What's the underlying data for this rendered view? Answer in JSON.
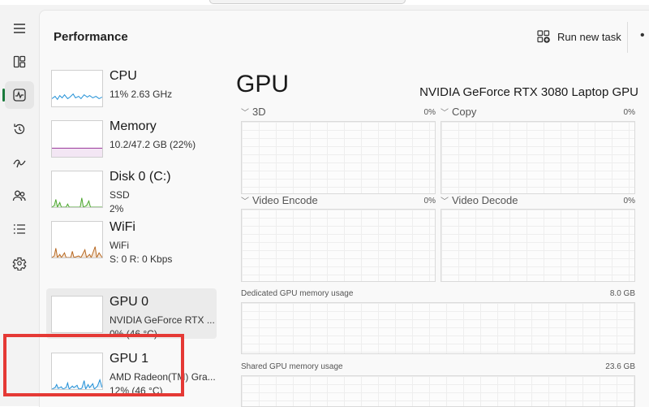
{
  "header": {
    "title": "Performance",
    "run_task_label": "Run new task",
    "more_glyph": "•"
  },
  "nav": {
    "items": [
      "hamburger-icon",
      "processes-icon",
      "performance-icon",
      "app-history-icon",
      "startup-apps-icon",
      "users-icon",
      "details-icon",
      "services-icon"
    ],
    "active": "performance-icon"
  },
  "resources": [
    {
      "name": "CPU",
      "line1": "11%  2.63 GHz",
      "line2": "",
      "line3": ""
    },
    {
      "name": "Memory",
      "line1": "10.2/47.2 GB (22%)",
      "line2": "",
      "line3": ""
    },
    {
      "name": "Disk 0 (C:)",
      "line1": "SSD",
      "line2": "2%",
      "line3": ""
    },
    {
      "name": "WiFi",
      "line1": "WiFi",
      "line2": "S: 0  R: 0 Kbps",
      "line3": ""
    },
    {
      "name": "GPU 0",
      "line1": "NVIDIA GeForce RTX ...",
      "line2": "0%  (46 °C)",
      "line3": ""
    },
    {
      "name": "GPU 1",
      "line1": "AMD Radeon(TM) Gra...",
      "line2": "12%  (46 °C)",
      "line3": ""
    }
  ],
  "detail": {
    "title": "GPU",
    "model": "NVIDIA GeForce RTX 3080 Laptop GPU",
    "engines": [
      {
        "label": "3D",
        "value": "0%"
      },
      {
        "label": "Copy",
        "value": "0%"
      },
      {
        "label": "Video Encode",
        "value": "0%"
      },
      {
        "label": "Video Decode",
        "value": "0%"
      }
    ],
    "dedicated": {
      "label": "Dedicated GPU memory usage",
      "value": "8.0 GB"
    },
    "shared": {
      "label": "Shared GPU memory usage",
      "value": "23.6 GB"
    }
  },
  "colors": {
    "cpu": "#1f8fd6",
    "memory": "#a349a4",
    "disk": "#4aa52c",
    "wifi": "#b5651d",
    "gpu": "#1f8fd6",
    "highlight": "#e53935",
    "active_indicator": "#1a7a3c"
  }
}
